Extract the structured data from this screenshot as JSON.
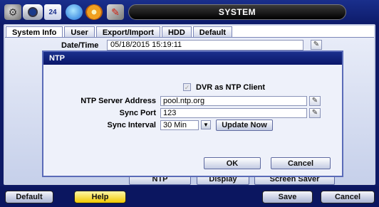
{
  "toolbar": {
    "title": "SYSTEM",
    "icons": [
      "setup-gear-icon",
      "camera-icon",
      "calendar-icon",
      "network-globe-icon",
      "record-disc-icon",
      "system-tools-icon"
    ],
    "calendar_text": "24"
  },
  "tabs": [
    {
      "label": "System Info",
      "active": true
    },
    {
      "label": "User",
      "active": false
    },
    {
      "label": "Export/Import",
      "active": false
    },
    {
      "label": "HDD",
      "active": false
    },
    {
      "label": "Default",
      "active": false
    }
  ],
  "system_info": {
    "date_time_label": "Date/Time",
    "date_time_value": "05/18/2015 15:19:11"
  },
  "ntp_dialog": {
    "title": "NTP",
    "client_checkbox_label": "DVR as NTP Client",
    "client_checked": true,
    "server_label": "NTP Server Address",
    "server_value": "pool.ntp.org",
    "port_label": "Sync Port",
    "port_value": "123",
    "interval_label": "Sync Interval",
    "interval_value": "30 Min",
    "update_now_label": "Update Now",
    "ok_label": "OK",
    "cancel_label": "Cancel"
  },
  "panel_buttons": {
    "ntp_label": "NTP",
    "display_label": "Display",
    "screen_saver_label": "Screen Saver"
  },
  "bottom_bar": {
    "default_label": "Default",
    "help_label": "Help",
    "save_label": "Save",
    "cancel_label": "Cancel"
  },
  "colors": {
    "background": "#0e1a66",
    "dialog_title_bar": "#1a2f8c",
    "help_button": "#f0c800"
  }
}
